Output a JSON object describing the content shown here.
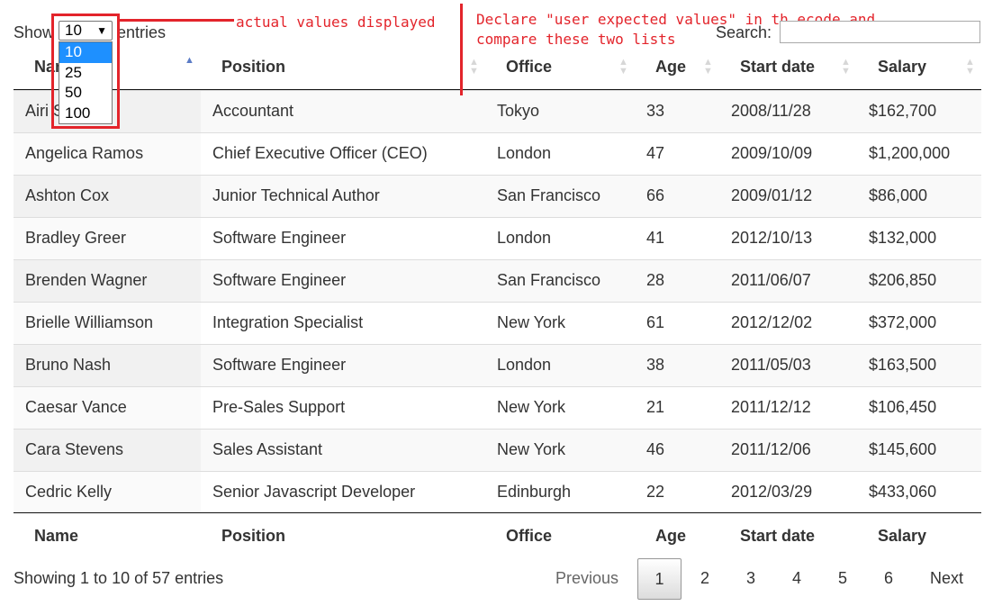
{
  "controls": {
    "show_label": "Show",
    "entries_label": "entries",
    "selected_length": "10",
    "length_options": [
      "10",
      "25",
      "50",
      "100"
    ],
    "search_label": "Search:",
    "search_value": ""
  },
  "annotations": {
    "note1": "actual values displayed",
    "note2": "Declare \"user expected values\" in th ecode and\ncompare these two lists",
    "color": "#e3242b"
  },
  "table": {
    "columns": [
      "Name",
      "Position",
      "Office",
      "Age",
      "Start date",
      "Salary"
    ],
    "sorted_column": "Name",
    "sort_direction": "ascending",
    "rows": [
      [
        "Airi Satou",
        "Accountant",
        "Tokyo",
        "33",
        "2008/11/28",
        "$162,700"
      ],
      [
        "Angelica Ramos",
        "Chief Executive Officer (CEO)",
        "London",
        "47",
        "2009/10/09",
        "$1,200,000"
      ],
      [
        "Ashton Cox",
        "Junior Technical Author",
        "San Francisco",
        "66",
        "2009/01/12",
        "$86,000"
      ],
      [
        "Bradley Greer",
        "Software Engineer",
        "London",
        "41",
        "2012/10/13",
        "$132,000"
      ],
      [
        "Brenden Wagner",
        "Software Engineer",
        "San Francisco",
        "28",
        "2011/06/07",
        "$206,850"
      ],
      [
        "Brielle Williamson",
        "Integration Specialist",
        "New York",
        "61",
        "2012/12/02",
        "$372,000"
      ],
      [
        "Bruno Nash",
        "Software Engineer",
        "London",
        "38",
        "2011/05/03",
        "$163,500"
      ],
      [
        "Caesar Vance",
        "Pre-Sales Support",
        "New York",
        "21",
        "2011/12/12",
        "$106,450"
      ],
      [
        "Cara Stevens",
        "Sales Assistant",
        "New York",
        "46",
        "2011/12/06",
        "$145,600"
      ],
      [
        "Cedric Kelly",
        "Senior Javascript Developer",
        "Edinburgh",
        "22",
        "2012/03/29",
        "$433,060"
      ]
    ]
  },
  "footer": {
    "info": "Showing 1 to 10 of 57 entries",
    "previous": "Previous",
    "next": "Next",
    "pages": [
      "1",
      "2",
      "3",
      "4",
      "5",
      "6"
    ],
    "current_page": "1"
  }
}
